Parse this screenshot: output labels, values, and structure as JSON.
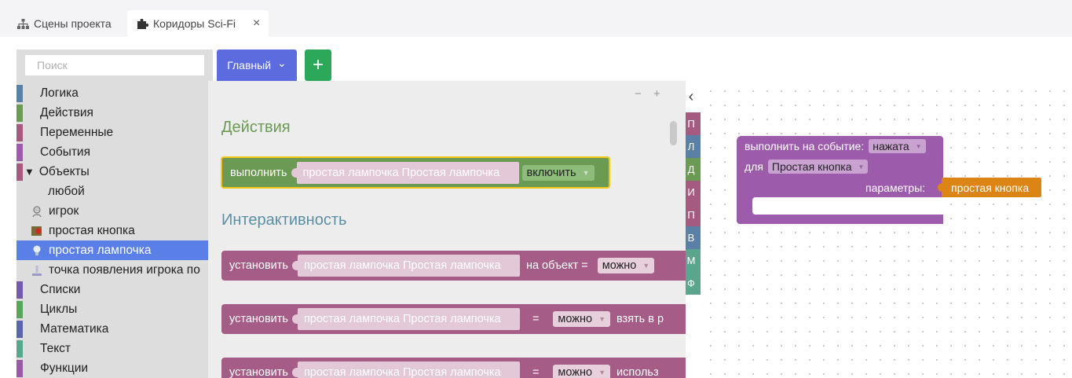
{
  "tabs": [
    {
      "label": "Сцены проекта",
      "icon": "sitemap-icon",
      "active": false
    },
    {
      "label": "Коридоры Sci-Fi",
      "icon": "puzzle-icon",
      "active": true,
      "close": "×"
    }
  ],
  "search": {
    "placeholder": "Поиск"
  },
  "categories": [
    {
      "label": "Логика",
      "color": "#5b80a5"
    },
    {
      "label": "Действия",
      "color": "#6b9a54"
    },
    {
      "label": "Переменные",
      "color": "#a55b80"
    },
    {
      "label": "События",
      "color": "#9c5cab"
    },
    {
      "label": "Объекты",
      "color": "#a55b80",
      "expanded": "▼"
    },
    {
      "label": "любой",
      "sub": true
    },
    {
      "label": "игрок",
      "sub": true,
      "icon": "player-icon"
    },
    {
      "label": "простая кнопка",
      "sub": true,
      "icon": "button-object-icon"
    },
    {
      "label": "простая лампочка",
      "sub": true,
      "icon": "lamp-icon",
      "selected": true
    },
    {
      "label": "точка появления игрока по",
      "sub": true,
      "icon": "spawn-point-icon"
    },
    {
      "label": "Списки",
      "color": "#745ba5"
    },
    {
      "label": "Циклы",
      "color": "#5ba55b"
    },
    {
      "label": "Математика",
      "color": "#5b67a5"
    },
    {
      "label": "Текст",
      "color": "#5ba58c"
    },
    {
      "label": "Функции",
      "color": "#9a5ba5"
    }
  ],
  "toolbar": {
    "main_label": "Главный",
    "main_arrow": "⌄",
    "add_label": "+"
  },
  "flyout": {
    "zoom_minus": "−",
    "zoom_plus": "+",
    "section_actions": "Действия",
    "section_interactive": "Интерактивность",
    "action_block": {
      "verb": "выполнить",
      "object": "простая лампочка Простая лампочка",
      "option": "включить"
    },
    "set_blocks": [
      {
        "verb": "установить",
        "object": "простая лампочка Простая лампочка",
        "middle": "на объект =",
        "value": "можно",
        "tail": ""
      },
      {
        "verb": "установить",
        "object": "простая лампочка Простая лампочка",
        "middle": "=",
        "value": "можно",
        "tail": "взять в р"
      },
      {
        "verb": "установить",
        "object": "простая лампочка Простая лампочка",
        "middle": "=",
        "value": "можно",
        "tail": "использ"
      }
    ]
  },
  "mini_categories": [
    {
      "letter": "П",
      "color": "#a55b80"
    },
    {
      "letter": "Л",
      "color": "#5b80a5"
    },
    {
      "letter": "Д",
      "color": "#6b9a54"
    },
    {
      "letter": "И",
      "color": "#a55b80"
    },
    {
      "letter": "П",
      "color": "#a55b80"
    },
    {
      "letter": "В",
      "color": "#5b80a5"
    },
    {
      "letter": "М",
      "color": "#5ba58c"
    },
    {
      "letter": "Ф",
      "color": "#5ba58c"
    }
  ],
  "collapse_icon": "‹",
  "event_block": {
    "label": "выполнить на событие:",
    "event": "нажата",
    "for_label": "для",
    "target": "Простая кнопка",
    "params_label": "параметры:",
    "param": "простая кнопка"
  },
  "colors": {
    "selected": "#5a7fe6",
    "main_button": "#5c6bde",
    "add_button": "#2ca85a",
    "event_block": "#9c5cab",
    "param": "#dd8514"
  }
}
